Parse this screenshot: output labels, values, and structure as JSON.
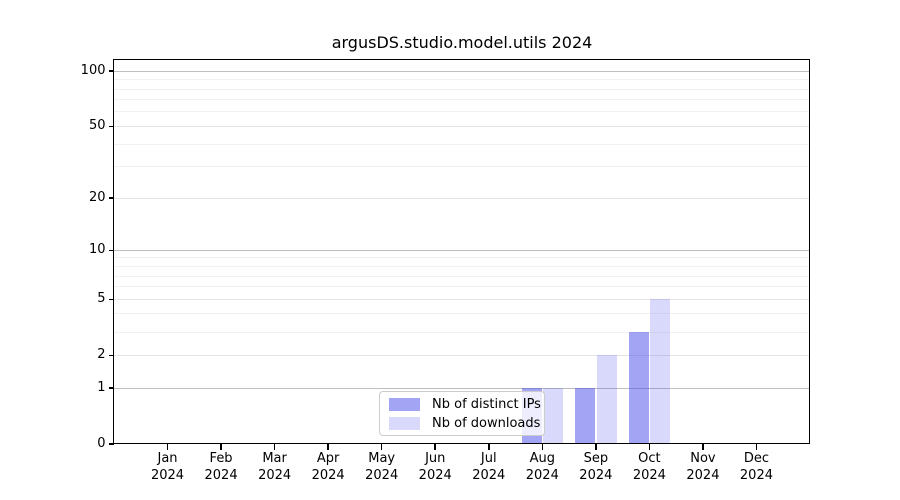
{
  "title": "argusDS.studio.model.utils 2024",
  "chart_data": {
    "type": "bar",
    "title": "argusDS.studio.model.utils 2024",
    "x_tick_months": [
      "Jan",
      "Feb",
      "Mar",
      "Apr",
      "May",
      "Jun",
      "Jul",
      "Aug",
      "Sep",
      "Oct",
      "Nov",
      "Dec"
    ],
    "x_tick_year": "2024",
    "y_scale": "log1p",
    "y_ticks": [
      0,
      1,
      2,
      5,
      10,
      20,
      50,
      100
    ],
    "y_minor_ticks": [
      3,
      4,
      6,
      7,
      8,
      9,
      30,
      40,
      60,
      70,
      80,
      90
    ],
    "y_max": 115,
    "grid": "both",
    "legend_position": "lower-center",
    "series": [
      {
        "name": "Nb of distinct IPs",
        "color": "rgba(80,80,235,0.52)",
        "values": [
          0,
          0,
          0,
          0,
          0,
          0,
          0,
          1,
          1,
          3,
          0,
          0
        ]
      },
      {
        "name": "Nb of downloads",
        "color": "rgba(80,80,235,0.22)",
        "values": [
          0,
          0,
          0,
          0,
          0,
          0,
          0,
          1,
          2,
          5,
          0,
          0
        ]
      }
    ]
  },
  "colors": {
    "grid_power10": "#bdbdbd",
    "grid_labeled": "#e3e3e3",
    "grid_minor": "#f1f1f1",
    "spine": "#000000",
    "text": "#000000",
    "legend_border": "#cccccc",
    "background": "#ffffff",
    "bar_distinct_ips": "rgba(80,80,235,0.52)",
    "bar_downloads": "rgba(80,80,235,0.22)"
  }
}
